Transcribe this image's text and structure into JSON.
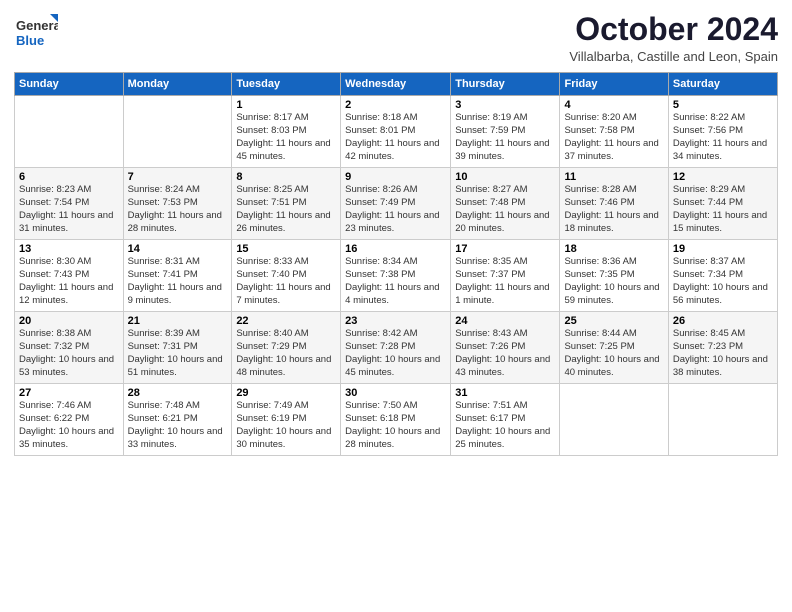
{
  "logo": {
    "general": "General",
    "blue": "Blue"
  },
  "header": {
    "month_year": "October 2024",
    "subtitle": "Villalbarba, Castille and Leon, Spain"
  },
  "days_of_week": [
    "Sunday",
    "Monday",
    "Tuesday",
    "Wednesday",
    "Thursday",
    "Friday",
    "Saturday"
  ],
  "weeks": [
    [
      {
        "day": "",
        "text": ""
      },
      {
        "day": "",
        "text": ""
      },
      {
        "day": "1",
        "text": "Sunrise: 8:17 AM\nSunset: 8:03 PM\nDaylight: 11 hours and 45 minutes."
      },
      {
        "day": "2",
        "text": "Sunrise: 8:18 AM\nSunset: 8:01 PM\nDaylight: 11 hours and 42 minutes."
      },
      {
        "day": "3",
        "text": "Sunrise: 8:19 AM\nSunset: 7:59 PM\nDaylight: 11 hours and 39 minutes."
      },
      {
        "day": "4",
        "text": "Sunrise: 8:20 AM\nSunset: 7:58 PM\nDaylight: 11 hours and 37 minutes."
      },
      {
        "day": "5",
        "text": "Sunrise: 8:22 AM\nSunset: 7:56 PM\nDaylight: 11 hours and 34 minutes."
      }
    ],
    [
      {
        "day": "6",
        "text": "Sunrise: 8:23 AM\nSunset: 7:54 PM\nDaylight: 11 hours and 31 minutes."
      },
      {
        "day": "7",
        "text": "Sunrise: 8:24 AM\nSunset: 7:53 PM\nDaylight: 11 hours and 28 minutes."
      },
      {
        "day": "8",
        "text": "Sunrise: 8:25 AM\nSunset: 7:51 PM\nDaylight: 11 hours and 26 minutes."
      },
      {
        "day": "9",
        "text": "Sunrise: 8:26 AM\nSunset: 7:49 PM\nDaylight: 11 hours and 23 minutes."
      },
      {
        "day": "10",
        "text": "Sunrise: 8:27 AM\nSunset: 7:48 PM\nDaylight: 11 hours and 20 minutes."
      },
      {
        "day": "11",
        "text": "Sunrise: 8:28 AM\nSunset: 7:46 PM\nDaylight: 11 hours and 18 minutes."
      },
      {
        "day": "12",
        "text": "Sunrise: 8:29 AM\nSunset: 7:44 PM\nDaylight: 11 hours and 15 minutes."
      }
    ],
    [
      {
        "day": "13",
        "text": "Sunrise: 8:30 AM\nSunset: 7:43 PM\nDaylight: 11 hours and 12 minutes."
      },
      {
        "day": "14",
        "text": "Sunrise: 8:31 AM\nSunset: 7:41 PM\nDaylight: 11 hours and 9 minutes."
      },
      {
        "day": "15",
        "text": "Sunrise: 8:33 AM\nSunset: 7:40 PM\nDaylight: 11 hours and 7 minutes."
      },
      {
        "day": "16",
        "text": "Sunrise: 8:34 AM\nSunset: 7:38 PM\nDaylight: 11 hours and 4 minutes."
      },
      {
        "day": "17",
        "text": "Sunrise: 8:35 AM\nSunset: 7:37 PM\nDaylight: 11 hours and 1 minute."
      },
      {
        "day": "18",
        "text": "Sunrise: 8:36 AM\nSunset: 7:35 PM\nDaylight: 10 hours and 59 minutes."
      },
      {
        "day": "19",
        "text": "Sunrise: 8:37 AM\nSunset: 7:34 PM\nDaylight: 10 hours and 56 minutes."
      }
    ],
    [
      {
        "day": "20",
        "text": "Sunrise: 8:38 AM\nSunset: 7:32 PM\nDaylight: 10 hours and 53 minutes."
      },
      {
        "day": "21",
        "text": "Sunrise: 8:39 AM\nSunset: 7:31 PM\nDaylight: 10 hours and 51 minutes."
      },
      {
        "day": "22",
        "text": "Sunrise: 8:40 AM\nSunset: 7:29 PM\nDaylight: 10 hours and 48 minutes."
      },
      {
        "day": "23",
        "text": "Sunrise: 8:42 AM\nSunset: 7:28 PM\nDaylight: 10 hours and 45 minutes."
      },
      {
        "day": "24",
        "text": "Sunrise: 8:43 AM\nSunset: 7:26 PM\nDaylight: 10 hours and 43 minutes."
      },
      {
        "day": "25",
        "text": "Sunrise: 8:44 AM\nSunset: 7:25 PM\nDaylight: 10 hours and 40 minutes."
      },
      {
        "day": "26",
        "text": "Sunrise: 8:45 AM\nSunset: 7:23 PM\nDaylight: 10 hours and 38 minutes."
      }
    ],
    [
      {
        "day": "27",
        "text": "Sunrise: 7:46 AM\nSunset: 6:22 PM\nDaylight: 10 hours and 35 minutes."
      },
      {
        "day": "28",
        "text": "Sunrise: 7:48 AM\nSunset: 6:21 PM\nDaylight: 10 hours and 33 minutes."
      },
      {
        "day": "29",
        "text": "Sunrise: 7:49 AM\nSunset: 6:19 PM\nDaylight: 10 hours and 30 minutes."
      },
      {
        "day": "30",
        "text": "Sunrise: 7:50 AM\nSunset: 6:18 PM\nDaylight: 10 hours and 28 minutes."
      },
      {
        "day": "31",
        "text": "Sunrise: 7:51 AM\nSunset: 6:17 PM\nDaylight: 10 hours and 25 minutes."
      },
      {
        "day": "",
        "text": ""
      },
      {
        "day": "",
        "text": ""
      }
    ]
  ]
}
